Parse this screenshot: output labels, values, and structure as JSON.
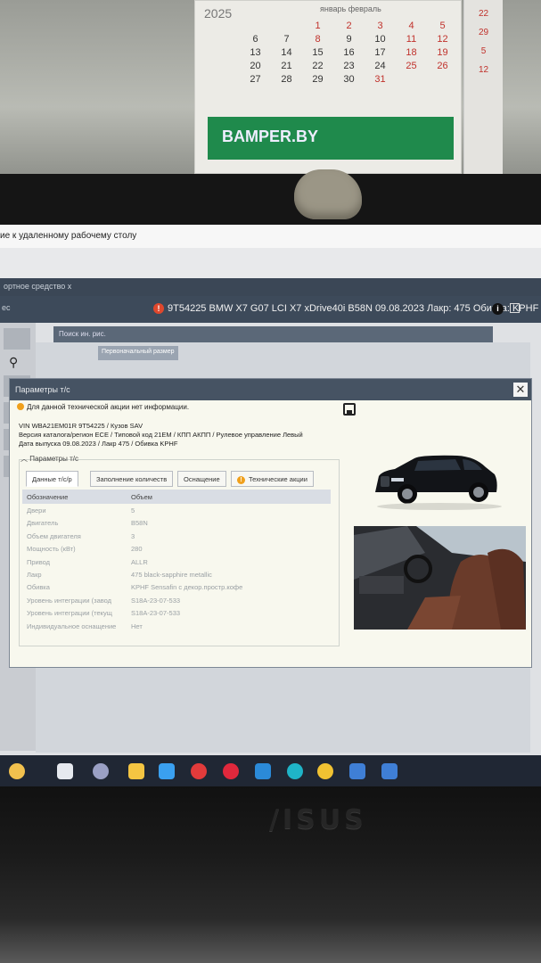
{
  "calendar": {
    "year": "2025",
    "month": "январь  февраль",
    "days": [
      {
        "d": "",
        "r": false
      },
      {
        "d": "",
        "r": false
      },
      {
        "d": "1",
        "r": true
      },
      {
        "d": "2",
        "r": true
      },
      {
        "d": "3",
        "r": true
      },
      {
        "d": "4",
        "r": true
      },
      {
        "d": "5",
        "r": true
      },
      {
        "d": "6",
        "r": false
      },
      {
        "d": "7",
        "r": false
      },
      {
        "d": "8",
        "r": true
      },
      {
        "d": "9",
        "r": false
      },
      {
        "d": "10",
        "r": false
      },
      {
        "d": "11",
        "r": true
      },
      {
        "d": "12",
        "r": true
      },
      {
        "d": "13",
        "r": false
      },
      {
        "d": "14",
        "r": false
      },
      {
        "d": "15",
        "r": false
      },
      {
        "d": "16",
        "r": false
      },
      {
        "d": "17",
        "r": false
      },
      {
        "d": "18",
        "r": true
      },
      {
        "d": "19",
        "r": true
      },
      {
        "d": "20",
        "r": false
      },
      {
        "d": "21",
        "r": false
      },
      {
        "d": "22",
        "r": false
      },
      {
        "d": "23",
        "r": false
      },
      {
        "d": "24",
        "r": false
      },
      {
        "d": "25",
        "r": true
      },
      {
        "d": "26",
        "r": true
      },
      {
        "d": "27",
        "r": false
      },
      {
        "d": "28",
        "r": false
      },
      {
        "d": "29",
        "r": false
      },
      {
        "d": "30",
        "r": false
      },
      {
        "d": "31",
        "r": true
      },
      {
        "d": "",
        "r": false
      },
      {
        "d": "",
        "r": false
      }
    ],
    "banner": "BAMPER.BY",
    "side": [
      "22",
      "29",
      "5",
      "12"
    ]
  },
  "rdp": {
    "title": "ие к удаленному рабочему столу"
  },
  "appbar": {
    "left": "ортное средство  x"
  },
  "vehbar": {
    "left": "ec",
    "title": "9T54225 BMW X7 G07 LCI X7 xDrive40i B58N 09.08.2023 Лакр: 475 Обивка: KPHF",
    "warn": "!",
    "info": "i"
  },
  "sec_bar": "Поиск ин. рис.",
  "size_btn": "Первоначальный размер",
  "dialog": {
    "title": "Параметры т/с",
    "close": "✕",
    "notice": "Для данной технической акции нет информации.",
    "vin_line": "VIN WBA21EM01R 9T54225 / Кузов SAV",
    "catalog_line": "Версия каталога/регион ECE / Типовой код 21EM / КПП АКПП / Рулевое управление Левый",
    "date_line": "Дата выпуска 09.08.2023 / Лакр 475 / Обивка KPHF",
    "group_label": "︿ Параметры т/с",
    "tabs": [
      {
        "label": "Данные т/с/р",
        "active": true,
        "warn": false
      },
      {
        "label": "Заполнение количеств",
        "active": false,
        "warn": false
      },
      {
        "label": "Оснащение",
        "active": false,
        "warn": false
      },
      {
        "label": "Технические акции",
        "active": false,
        "warn": true
      }
    ],
    "table": {
      "headers": [
        "Обозначение",
        "Объем"
      ],
      "rows": [
        [
          "Двери",
          "5"
        ],
        [
          "Двигатель",
          "B58N"
        ],
        [
          "Объем двигателя",
          "3"
        ],
        [
          "Мощность (кВт)",
          "280"
        ],
        [
          "Привод",
          "ALLR"
        ],
        [
          "Лакр",
          "475 black-sapphire metallic"
        ],
        [
          "Обивка",
          "KPHF Sensafin с декор.простр.кофе"
        ],
        [
          "Уровень интеграции (завод",
          "S18A-23-07-533"
        ],
        [
          "Уровень интеграции (текущ",
          "S18A-23-07-533"
        ],
        [
          "Индивидуальное оснащение",
          "Нет"
        ]
      ]
    }
  },
  "bezel": {
    "brand": "/ISUS"
  },
  "colors": {
    "dialog_header": "#465363",
    "vehbar": "#3d4a5a",
    "warn": "#e0482d",
    "notice": "#f0a01c",
    "taskbar": "#202734"
  },
  "taskbar_icons": [
    {
      "name": "copilot-icon",
      "color": "#f2c14e"
    },
    {
      "name": "taskview-icon",
      "color": "#e6e9ef"
    },
    {
      "name": "circle-app-icon",
      "color": "#9aa0c4"
    },
    {
      "name": "file-explorer-icon",
      "color": "#f4c542"
    },
    {
      "name": "store-icon",
      "color": "#3aa0f0"
    },
    {
      "name": "yandex-browser-icon",
      "color": "#e23b3b"
    },
    {
      "name": "opera-icon",
      "color": "#e0283c"
    },
    {
      "name": "mail-icon",
      "color": "#2b8ad8"
    },
    {
      "name": "edge-icon",
      "color": "#1fb4c8"
    },
    {
      "name": "chrome-icon",
      "color": "#f1c232"
    },
    {
      "name": "remote-desktop-icon",
      "color": "#3f7fd6"
    },
    {
      "name": "remote-desktop-icon-2",
      "color": "#3f7fd6"
    }
  ]
}
